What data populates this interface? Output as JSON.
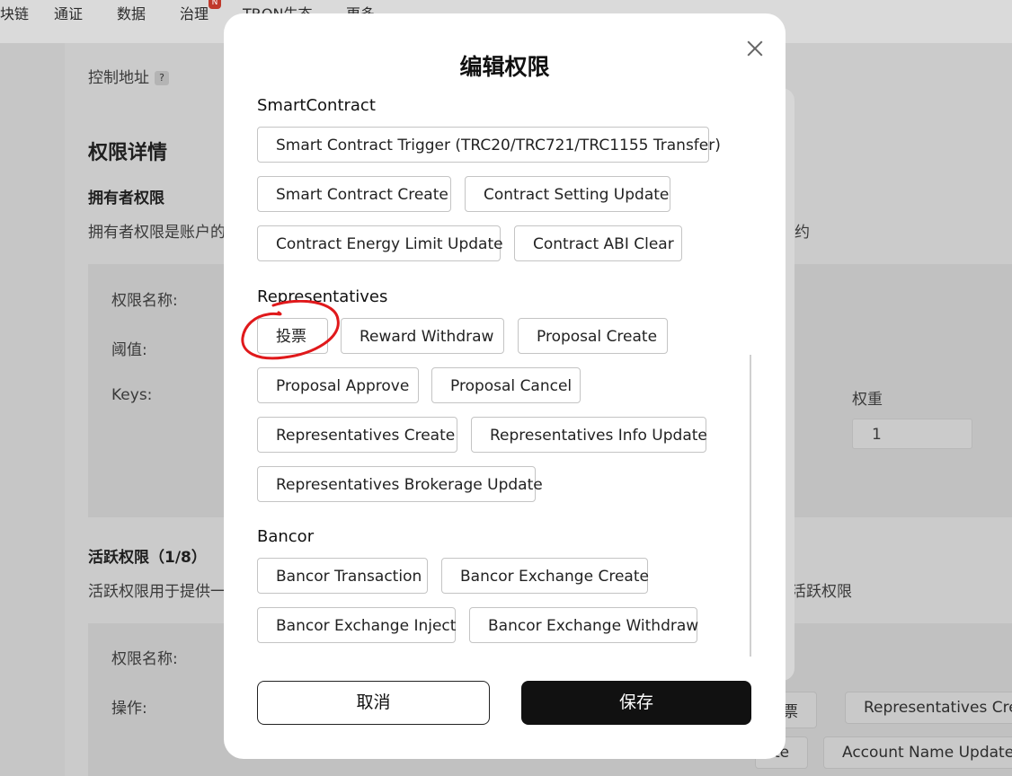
{
  "background": {
    "nav": [
      "块链",
      "通证",
      "数据",
      "治理",
      "TRON生态",
      "更多"
    ],
    "nav_badge": "N",
    "control_address_label": "控制地址",
    "help_glyph": "?",
    "permission_details": "权限详情",
    "owner_permission": "拥有者权限",
    "owner_desc_left": "拥有者权限是账户的",
    "owner_desc_right": "约",
    "perm_name_label": "权限名称:",
    "threshold_label": "阈值:",
    "keys_label": "Keys:",
    "weight_label": "权重",
    "weight_value": "1",
    "active_permission": "活跃权限（1/8）",
    "active_desc_left": "活跃权限用于提供一",
    "active_desc_right": "活跃权限",
    "perm_name_label2": "权限名称:",
    "operation_label": "操作:",
    "chip_vote": "票",
    "chip_rep_create": "Representatives Crea",
    "chip_update": "te",
    "chip_account_name": "Account Name Update"
  },
  "modal": {
    "title": "编辑权限",
    "sections": {
      "smartcontract": {
        "title": "SmartContract",
        "items": [
          "Smart Contract Trigger (TRC20/TRC721/TRC1155 Transfer)",
          "Smart Contract Create",
          "Contract Setting Update",
          "Contract Energy Limit Update",
          "Contract ABI Clear"
        ]
      },
      "representatives": {
        "title": "Representatives",
        "items": [
          "投票",
          "Reward Withdraw",
          "Proposal Create",
          "Proposal Approve",
          "Proposal Cancel",
          "Representatives Create",
          "Representatives Info Update",
          "Representatives Brokerage Update"
        ]
      },
      "bancor": {
        "title": "Bancor",
        "items": [
          "Bancor Transaction",
          "Bancor Exchange Create",
          "Bancor Exchange Inject",
          "Bancor Exchange Withdraw"
        ]
      }
    },
    "cancel_label": "取消",
    "save_label": "保存"
  },
  "colors": {
    "overlay": "#c6c6c6",
    "save_bg": "#111111",
    "annotation": "#e0191b"
  }
}
